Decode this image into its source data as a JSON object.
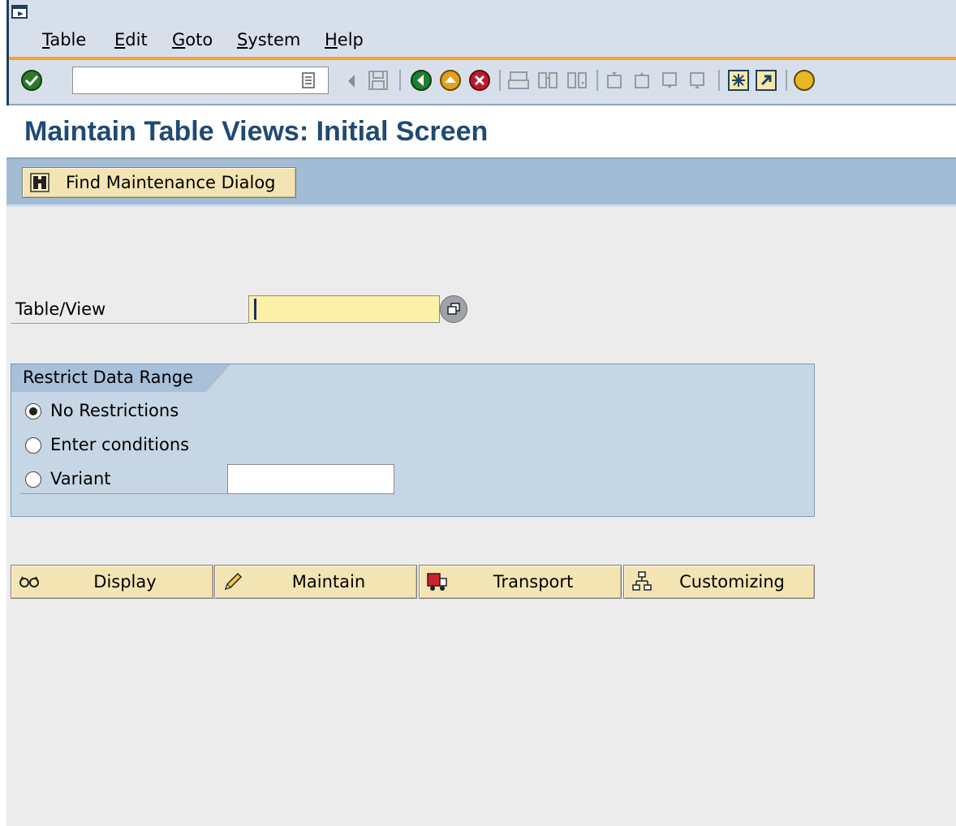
{
  "menu": {
    "items": [
      {
        "label": "Table"
      },
      {
        "label": "Edit"
      },
      {
        "label": "Goto"
      },
      {
        "label": "System"
      },
      {
        "label": "Help"
      }
    ]
  },
  "toolbar": {
    "command_field_value": ""
  },
  "page": {
    "title": "Maintain Table Views: Initial Screen"
  },
  "appbar": {
    "find_button_label": "Find Maintenance Dialog"
  },
  "form": {
    "table_view_label": "Table/View",
    "table_view_value": ""
  },
  "restrict": {
    "group_title": "Restrict Data Range",
    "options": [
      {
        "label": "No Restrictions",
        "selected": true
      },
      {
        "label": "Enter conditions",
        "selected": false
      },
      {
        "label": "Variant",
        "selected": false
      }
    ],
    "variant_value": ""
  },
  "actions": [
    {
      "label": "Display",
      "icon": "glasses-icon"
    },
    {
      "label": "Maintain",
      "icon": "pencil-icon"
    },
    {
      "label": "Transport",
      "icon": "truck-icon"
    },
    {
      "label": "Customizing",
      "icon": "hierarchy-icon"
    }
  ],
  "colors": {
    "title": "#1f4a74",
    "button_bg": "#f3e4b3",
    "required_field": "#fbf0a7",
    "accent_orange": "#f0a52b"
  }
}
